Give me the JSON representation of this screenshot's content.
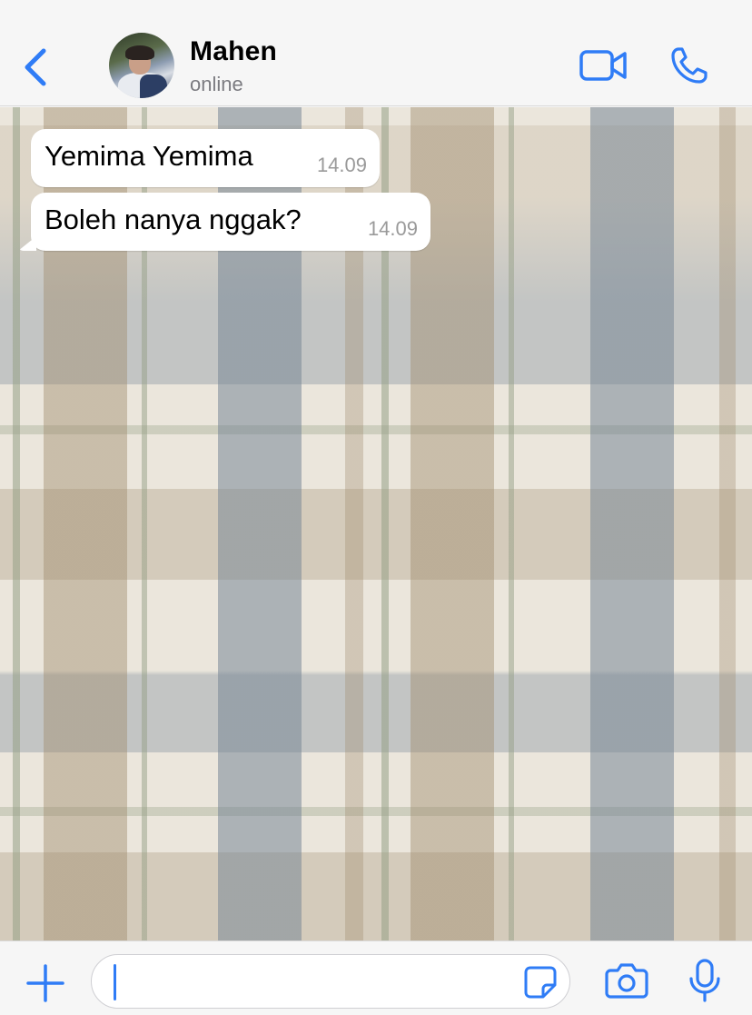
{
  "header": {
    "contact_name": "Mahen",
    "contact_status": "online"
  },
  "messages": [
    {
      "text": "Yemima Yemima",
      "time": "14.09",
      "direction": "incoming"
    },
    {
      "text": "Boleh nanya nggak?",
      "time": "14.09",
      "direction": "incoming"
    }
  ],
  "input": {
    "value": "",
    "placeholder": ""
  },
  "icons": {
    "back": "chevron-left-icon",
    "video": "video-camera-icon",
    "call": "phone-icon",
    "add": "plus-icon",
    "sticker": "sticker-icon",
    "camera": "camera-icon",
    "microphone": "microphone-icon"
  },
  "colors": {
    "accent": "#2f7cf6",
    "bubble": "#ffffff",
    "timestamp": "#9a9a9a",
    "status": "#7b7b80"
  }
}
